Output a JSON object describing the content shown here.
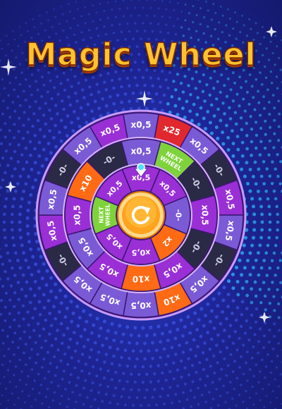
{
  "title": "Magic Wheel",
  "colors": {
    "background": "#1e2596",
    "title": "#ffc22e",
    "purple": "#9a2fd6",
    "lavender": "#7b5ad6",
    "dark": "#2b2a46",
    "orange": "#ff6a14",
    "red": "#e0282e",
    "green": "#7ed33a",
    "hub": "#ffa21e"
  },
  "wheel": {
    "outer_ring": [
      {
        "label": "x0,5",
        "color": "lavender"
      },
      {
        "label": "x25",
        "color": "red"
      },
      {
        "label": "x0,5",
        "color": "lavender"
      },
      {
        "label": "-0-",
        "color": "dark"
      },
      {
        "label": "x0,5",
        "color": "purple"
      },
      {
        "label": "x0,5",
        "color": "lavender"
      },
      {
        "label": "-0-",
        "color": "dark"
      },
      {
        "label": "x0,5",
        "color": "lavender"
      },
      {
        "label": "x10",
        "color": "orange"
      },
      {
        "label": "x0,5",
        "color": "lavender"
      },
      {
        "label": "x0,5",
        "color": "lavender"
      },
      {
        "label": "x0,5",
        "color": "lavender"
      },
      {
        "label": "-0-",
        "color": "dark"
      },
      {
        "label": "x0,5",
        "color": "purple"
      },
      {
        "label": "x0,5",
        "color": "lavender"
      },
      {
        "label": "-0-",
        "color": "dark"
      },
      {
        "label": "x0,5",
        "color": "lavender"
      },
      {
        "label": "x0,5",
        "color": "purple"
      }
    ],
    "middle_ring": [
      {
        "label": "x0,5",
        "color": "lavender"
      },
      {
        "label": "NEXT WHEEL",
        "color": "green"
      },
      {
        "label": "-0-",
        "color": "dark"
      },
      {
        "label": "x0,5",
        "color": "purple"
      },
      {
        "label": "-0-",
        "color": "dark"
      },
      {
        "label": "x0,5",
        "color": "purple"
      },
      {
        "label": "x10",
        "color": "orange"
      },
      {
        "label": "x0,5",
        "color": "purple"
      },
      {
        "label": "x0,5",
        "color": "lavender"
      },
      {
        "label": "x0,5",
        "color": "purple"
      },
      {
        "label": "x10",
        "color": "orange"
      },
      {
        "label": "-0-",
        "color": "dark"
      }
    ],
    "inner_ring": [
      {
        "label": "x0,5",
        "color": "purple"
      },
      {
        "label": "x0,5",
        "color": "purple"
      },
      {
        "label": "-0-",
        "color": "lavender"
      },
      {
        "label": "x2",
        "color": "orange"
      },
      {
        "label": "x0,5",
        "color": "purple"
      },
      {
        "label": "x0,5",
        "color": "purple"
      },
      {
        "label": "NEXT WHEEL",
        "color": "green"
      },
      {
        "label": "x0,5",
        "color": "purple"
      }
    ],
    "spin_icon": "spin-arrow-icon",
    "pointer_icon": "pointer-arrow-icon"
  }
}
